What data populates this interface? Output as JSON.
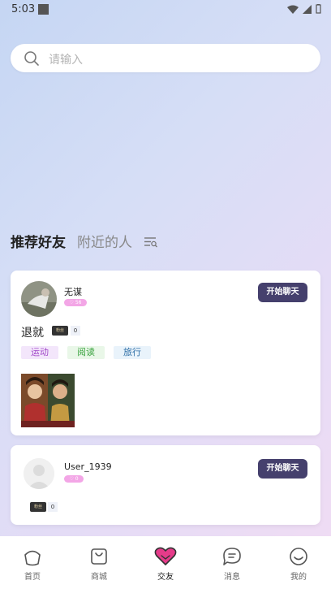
{
  "status": {
    "time": "5:03"
  },
  "search": {
    "placeholder": "请输入"
  },
  "tabs": {
    "active": "推荐好友",
    "inactive": "附近的人"
  },
  "cards": [
    {
      "username": "无谋",
      "vip_level": "56",
      "chat_label": "开始聊天",
      "bio": "退就",
      "fans_label": "粉丝",
      "fans_count": "0",
      "tags": [
        "运动",
        "阅读",
        "旅行"
      ]
    },
    {
      "username": "User_1939",
      "vip_level": "0",
      "chat_label": "开始聊天",
      "fans_label": "粉丝",
      "fans_count": "0"
    }
  ],
  "nav": [
    {
      "label": "首页",
      "icon": "home-icon"
    },
    {
      "label": "商城",
      "icon": "shopping-bag-icon"
    },
    {
      "label": "交友",
      "icon": "heart-icon",
      "active": true
    },
    {
      "label": "消息",
      "icon": "chat-bubble-icon"
    },
    {
      "label": "我的",
      "icon": "smile-face-icon"
    }
  ],
  "colors": {
    "accent": "#45406d",
    "active_heart": "#e63b8a",
    "vip": "#f3a6e6"
  }
}
